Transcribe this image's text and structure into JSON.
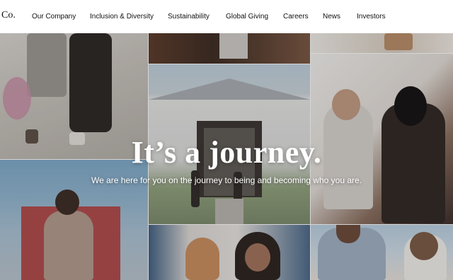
{
  "header": {
    "logo_text": "Co.",
    "nav": [
      "Our Company",
      "Inclusion & Diversity",
      "Sustainability",
      "Global Giving",
      "Careers",
      "News",
      "Investors"
    ]
  },
  "hero": {
    "headline": "It’s a journey.",
    "subheading": "We are here for you on the journey to being and becoming who you are."
  },
  "colors": {
    "nav_background": "#ffffff",
    "nav_text": "#111111",
    "hero_text": "#ffffff"
  }
}
